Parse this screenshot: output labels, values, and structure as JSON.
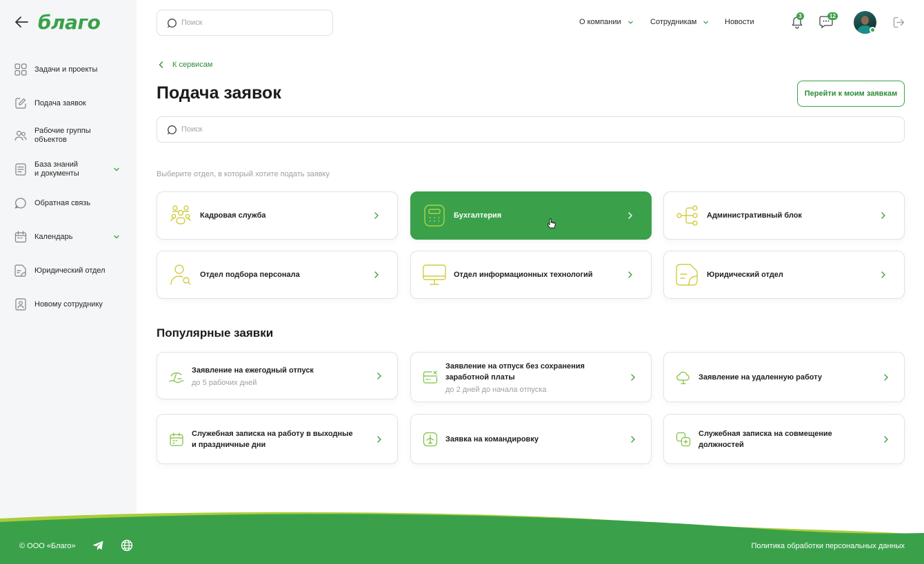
{
  "brand": {
    "logo_text": "благо",
    "accent": "#3aa14a"
  },
  "sidebar": {
    "items": [
      {
        "label": "Задачи и проекты",
        "icon": "grid-icon"
      },
      {
        "label": "Подача заявок",
        "icon": "edit-icon"
      },
      {
        "label": "Рабочие группы\nобъектов",
        "icon": "users-icon"
      },
      {
        "label": "База знаний\nи документы",
        "icon": "document-icon",
        "has_submenu": true
      },
      {
        "label": "Обратная связь",
        "icon": "feedback-icon"
      },
      {
        "label": "Календарь",
        "icon": "calendar-icon",
        "has_submenu": true
      },
      {
        "label": "Юридический отдел",
        "icon": "legal-doc-icon"
      },
      {
        "label": "Новому сотруднику",
        "icon": "badge-icon"
      }
    ]
  },
  "header": {
    "search_placeholder": "Поиск",
    "nav": [
      {
        "label": "О компании",
        "dropdown": true
      },
      {
        "label": "Сотрудникам",
        "dropdown": true
      },
      {
        "label": "Новости",
        "dropdown": false
      }
    ],
    "notifications_count": "3",
    "messages_count": "12"
  },
  "main": {
    "breadcrumb": "К сервисам",
    "title": "Подача заявок",
    "my_requests_button": "Перейти к моим заявкам",
    "search_placeholder": "Поиск",
    "hint": "Выберите отдел, в который хотите подать заявку",
    "departments": [
      {
        "label": "Кадровая служба",
        "icon": "people-group-icon",
        "active": false
      },
      {
        "label": "Бухгалтерия",
        "icon": "calculator-icon",
        "active": true
      },
      {
        "label": "Административный блок",
        "icon": "hierarchy-icon",
        "active": false
      },
      {
        "label": "Отдел подбора персонала",
        "icon": "user-search-icon",
        "active": false
      },
      {
        "label": "Отдел информационных технологий",
        "icon": "monitor-icon",
        "active": false
      },
      {
        "label": "Юридический отдел",
        "icon": "legal-doc-icon",
        "active": false
      }
    ],
    "popular_title": "Популярные заявки",
    "popular": [
      {
        "label": "Заявление на ежегодный отпуск",
        "sub": "до 5 рабочих дней",
        "icon": "beach-icon"
      },
      {
        "label": "Заявление на отпуск без сохранения\nзаработной платы",
        "sub": "до 2 дней до начала отпуска",
        "icon": "card-cancel-icon"
      },
      {
        "label": "Заявление на удаленную работу",
        "sub": "",
        "icon": "cloud-icon"
      },
      {
        "label": "Служебная записка на работу в выходные\nи праздничные дни",
        "sub": "",
        "icon": "calendar-icon"
      },
      {
        "label": "Заявка на командировку",
        "sub": "",
        "icon": "airplane-icon"
      },
      {
        "label": "Служебная записка на совмещение\nдолжностей",
        "sub": "",
        "icon": "copy-add-icon"
      }
    ]
  },
  "footer": {
    "copyright": "© ООО «Благо»",
    "policy": "Политика обработки персональных данных",
    "icons": [
      "telegram-icon",
      "globe-icon"
    ]
  }
}
